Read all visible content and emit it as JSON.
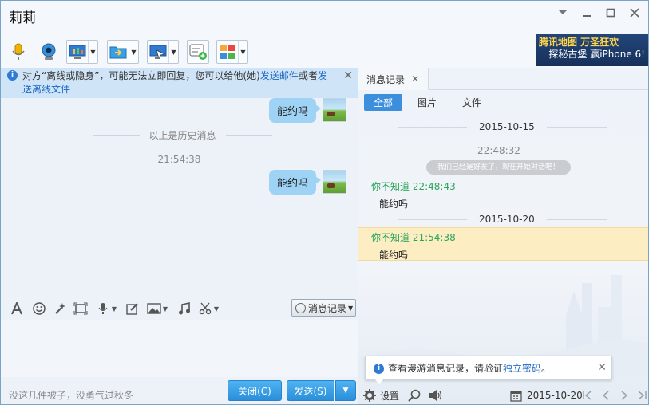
{
  "window": {
    "title": "莉莉",
    "controls": [
      "chevron-down",
      "minimize",
      "maximize",
      "close"
    ]
  },
  "ad": {
    "line1": "腾讯地图 万圣狂欢",
    "line2": "探秘古堡 赢iPhone 6!"
  },
  "notice": {
    "text_pre": "对方“离线或隐身”，可能无法立即回复，您可以给他(她)",
    "link1": "发送邮件",
    "text_mid": "或者",
    "link2": "发送离线文件",
    "close": "✕"
  },
  "chat": {
    "messages": [
      {
        "text": "能约吗"
      },
      {
        "text": "能约吗"
      }
    ],
    "history_divider": "以上是历史消息",
    "timestamp": "21:54:38"
  },
  "input_toolbar": {
    "message_record_label": "消息记录"
  },
  "footer": {
    "signature": "没这几件被子，没勇气过秋冬",
    "close_label": "关闭(C)",
    "send_label": "发送(S)"
  },
  "history_panel": {
    "tab_label": "消息记录",
    "filters": [
      "全部",
      "图片",
      "文件"
    ],
    "active_filter": "全部",
    "date1": "2015-10-15",
    "time1": "22:48:32",
    "system_message": "我们已经是好友了，现在开始对话吧！",
    "entry1": {
      "sender": "你不知道",
      "time": "22:48:43",
      "text": "能约吗"
    },
    "date2": "2015-10-20",
    "entry2": {
      "sender": "你不知道",
      "time": "21:54:38",
      "text": "能约吗"
    },
    "tip": {
      "text_pre": "查看漫游消息记录，请验证",
      "link": "独立密码",
      "text_post": "。"
    },
    "settings_label": "设置",
    "date_field": "2015-10-20"
  },
  "colors": {
    "accent": "#3c8fdc",
    "bubble": "#9ed3f5",
    "sender": "#2aa55a",
    "highlight": "#fcedc3"
  }
}
